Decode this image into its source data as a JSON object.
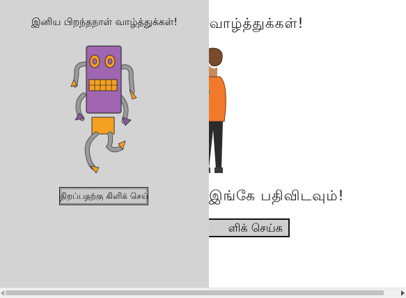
{
  "background_page": {
    "heading": "ர் வாழ்த்துக்கள்!",
    "prompt": "இங்கே பதிவிடவும்!",
    "button_label": "ளிக் செய்க"
  },
  "panel": {
    "title": "இனிய பிறந்தநாள் வாழ்த்துக்கள்!",
    "button_label": "திறப்பதற்கு கிளிக் செய்க",
    "image_icon": "robot-illustration"
  },
  "colors": {
    "panel_bg": "#d3d3d3",
    "robot_body": "#a066b0",
    "robot_accent": "#f5a020"
  }
}
